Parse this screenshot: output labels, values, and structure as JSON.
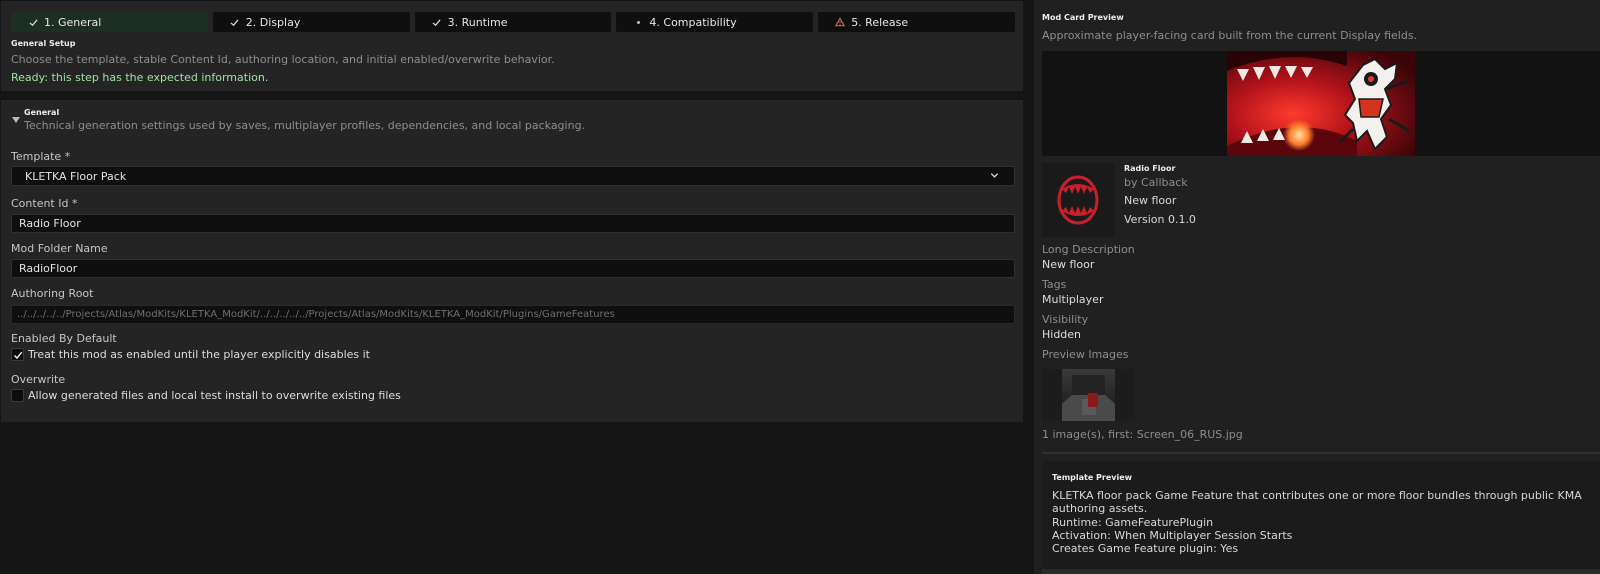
{
  "steps": [
    {
      "label": "1. General",
      "state": "done"
    },
    {
      "label": "2. Display",
      "state": "done"
    },
    {
      "label": "3. Runtime",
      "state": "done"
    },
    {
      "label": "4. Compatibility",
      "state": "pending"
    },
    {
      "label": "5. Release",
      "state": "warning"
    }
  ],
  "setup": {
    "title": "General Setup",
    "description": "Choose the template, stable Content Id, authoring location, and initial enabled/overwrite behavior.",
    "status": "Ready: this step has the expected information."
  },
  "general": {
    "title": "General",
    "description": "Technical generation settings used by saves, multiplayer profiles, dependencies, and local packaging.",
    "template_label": "Template *",
    "template_value": "KLETKA Floor Pack",
    "content_id_label": "Content Id *",
    "content_id_value": "Radio Floor",
    "folder_label": "Mod Folder Name",
    "folder_value": "RadioFloor",
    "authoring_root_label": "Authoring Root",
    "authoring_root_value": "../../../../../Projects/Atlas/ModKits/KLETKA_ModKit/../../../../../Projects/Atlas/ModKits/KLETKA_ModKit/Plugins/GameFeatures",
    "enabled_label": "Enabled By Default",
    "enabled_checkbox_label": "Treat this mod as enabled until the player explicitly disables it",
    "enabled_checked": true,
    "overwrite_label": "Overwrite",
    "overwrite_checkbox_label": "Allow generated files and local test install to overwrite existing files",
    "overwrite_checked": false
  },
  "preview": {
    "title": "Mod Card Preview",
    "description": "Approximate player-facing card built from the current Display fields.",
    "name": "Radio Floor",
    "author": "by Callback",
    "short_description": "New floor",
    "version": "Version 0.1.0",
    "long_description_label": "Long Description",
    "long_description_value": "New floor",
    "tags_label": "Tags",
    "tags_value": "Multiplayer",
    "visibility_label": "Visibility",
    "visibility_value": "Hidden",
    "preview_images_label": "Preview Images",
    "images_summary": "1 image(s), first: Screen_06_RUS.jpg"
  },
  "template_preview": {
    "title": "Template Preview",
    "description": "KLETKA floor pack Game Feature that contributes one or more floor bundles through public KMA authoring assets.",
    "runtime": "Runtime: GameFeaturePlugin",
    "activation": "Activation: When Multiplayer Session Starts",
    "creates_plugin": "Creates Game Feature plugin: Yes"
  },
  "colors": {
    "accent_green": "#9fe0a5",
    "active_step": "#1d2f22",
    "warning": "#e06c5a",
    "brand_red": "#c8202a"
  },
  "icons": {
    "done": "check-icon",
    "pending": "dot-icon",
    "warning": "warning-triangle-icon"
  }
}
